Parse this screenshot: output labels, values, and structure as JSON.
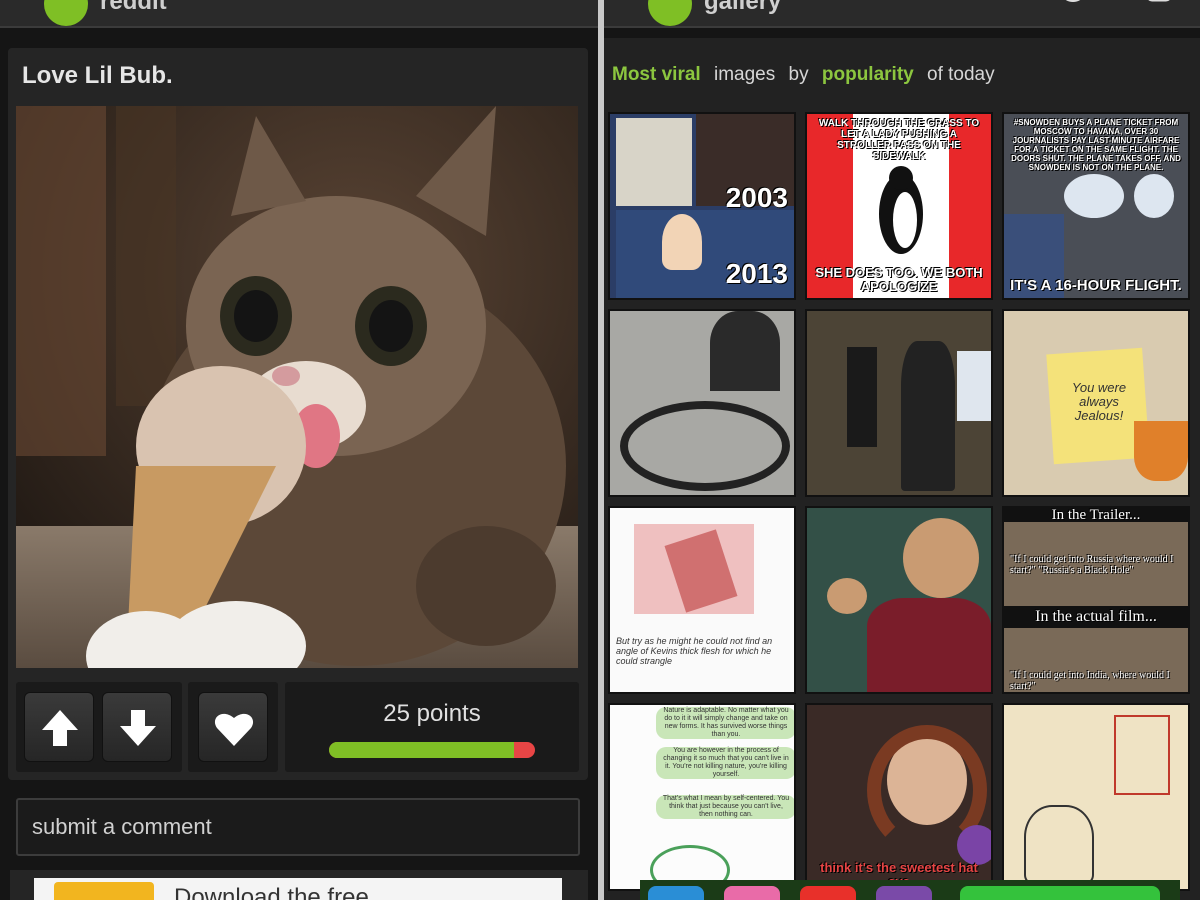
{
  "left": {
    "topbar": {
      "app_name": "reddit"
    },
    "post": {
      "title": "Love Lil Bub.",
      "points_label": "25 points",
      "upvote_ratio": 0.9
    },
    "comment": {
      "placeholder": "submit a comment"
    },
    "ad": {
      "text": "Download the free"
    }
  },
  "right": {
    "topbar": {
      "app_name": "gallery"
    },
    "header": {
      "part1": "Most viral",
      "part2": "images",
      "part3": "by",
      "part4": "popularity",
      "part5": "of today"
    },
    "tiles": [
      {
        "caption_top": "",
        "caption_bottom": "",
        "label1": "2003",
        "label2": "2013"
      },
      {
        "caption_top": "WALK THROUGH THE GRASS TO LET A LADY PUSHING A STROLLER PASS ON THE SIDEWALK",
        "caption_bottom": "SHE DOES TOO. WE BOTH APOLOGIZE"
      },
      {
        "caption_top": "#SNOWDEN BUYS A PLANE TICKET FROM MOSCOW TO HAVANA, OVER 30 JOURNALISTS PAY LAST-MINUTE AIRFARE FOR A TICKET ON THE SAME FLIGHT. THE DOORS SHUT. THE PLANE TAKES OFF, AND SNOWDEN IS NOT ON THE PLANE.",
        "caption_bottom": "IT'S A 16-HOUR FLIGHT."
      },
      {
        "caption_top": "",
        "caption_bottom": ""
      },
      {
        "caption_top": "",
        "caption_bottom": ""
      },
      {
        "caption_top": "",
        "caption_bottom": "",
        "note": "You were always Jealous!"
      },
      {
        "caption_top": "",
        "caption_bottom": "",
        "note": "But try as he might he could not find an angle of Kevins thick flesh for which he could strangle"
      },
      {
        "caption_top": "",
        "caption_bottom": ""
      },
      {
        "caption_top": "In the Trailer...",
        "caption_bottom": "In the actual film...",
        "q1": "\"If I could get into Russia where would I start?\" \"Russia's a Black Hole\"",
        "q2": "\"If I could get into India, where would I start?\""
      },
      {
        "caption_top": "",
        "caption_bottom": "",
        "bubble1": "Nature is adaptable. No matter what you do to it it will simply change and take on new forms. It has survived worse things than you.",
        "bubble2": "You are however in the process of changing it so much that you can't live in it. You're not killing nature, you're killing yourself.",
        "bubble3": "That's what I mean by self-centered. You think that just because you can't live, then nothing can."
      },
      {
        "caption_top": "",
        "caption_bottom": "think it's the sweetest hat eve"
      },
      {
        "caption_top": "",
        "caption_bottom": ""
      }
    ]
  },
  "colors": {
    "accent": "#8cc63f",
    "downvote": "#e84545"
  }
}
